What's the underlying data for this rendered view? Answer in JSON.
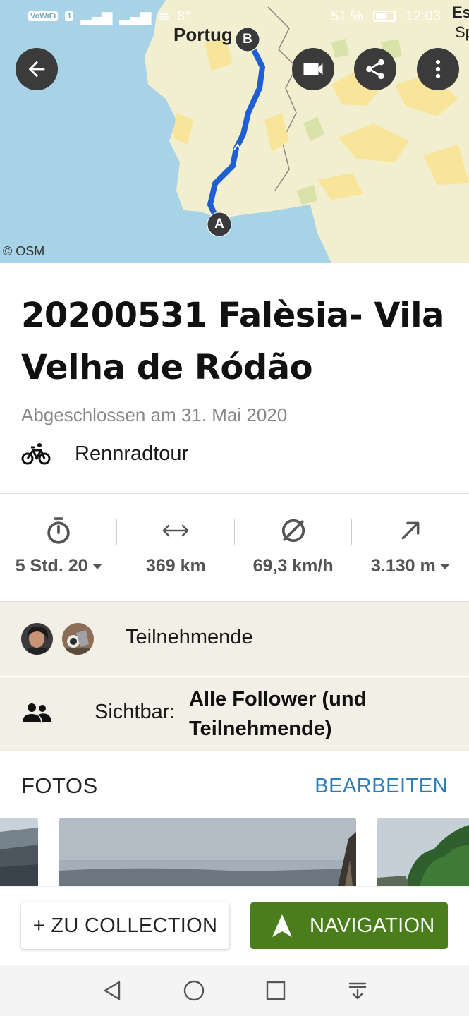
{
  "status_bar": {
    "wifi_badge": "VoWiFi",
    "sim_badge": "1",
    "temperature": "8°",
    "battery": "51 %",
    "time": "12:03"
  },
  "map": {
    "labels": [
      "Portug",
      "Es",
      "Sp"
    ],
    "start_marker": "A",
    "end_marker": "B",
    "attribution": "© OSM",
    "colors": {
      "sea": "#a8d3e6",
      "land": "#f1efcf",
      "highlight": "#f8e59a",
      "route": "#1f5fd1"
    }
  },
  "tour": {
    "title": "20200531 Falèsia- Vila Velha de Ródão",
    "completed": "Abgeschlossen am 31. Mai 2020",
    "sport_icon": "road-bike-icon",
    "sport": "Rennradtour"
  },
  "stats": [
    {
      "icon": "stopwatch-icon",
      "value": "5 Std. 20",
      "dropdown": true
    },
    {
      "icon": "distance-arrows-icon",
      "value": "369 km",
      "dropdown": false
    },
    {
      "icon": "average-speed-icon",
      "value": "69,3 km/h",
      "dropdown": false
    },
    {
      "icon": "elevation-up-icon",
      "value": "3.130 m",
      "dropdown": true
    }
  ],
  "participants": {
    "label": "Teilnehmende",
    "avatars": [
      "avatar-1",
      "avatar-2"
    ]
  },
  "visibility": {
    "label": "Sichtbar:",
    "value": "Alle Follower (und Teilnehmende)"
  },
  "photos": {
    "title": "FOTOS",
    "edit_label": "BEARBEITEN"
  },
  "actions": {
    "collection_label": "+ ZU COLLECTION",
    "navigation_label": "NAVIGATION"
  },
  "accent": {
    "nav_green": "#4a7d1b",
    "link_blue": "#2f7db5"
  }
}
